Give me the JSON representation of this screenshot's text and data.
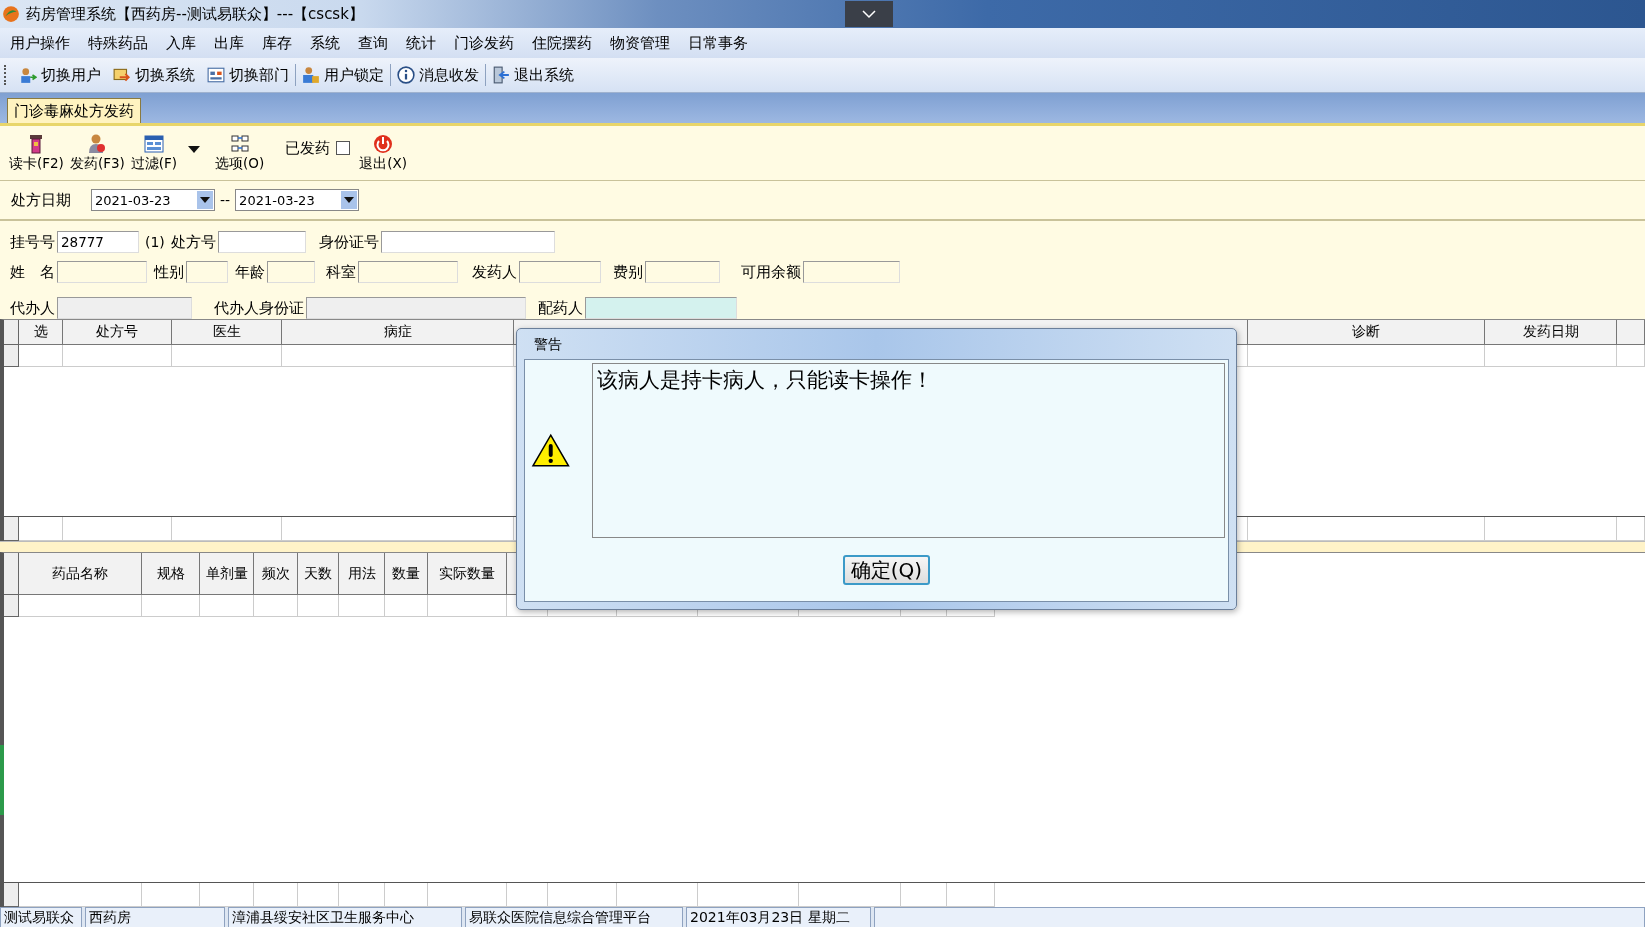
{
  "window": {
    "title": "药房管理系统【西药房--测试易联众】---【cscsk】"
  },
  "menu": [
    "用户操作",
    "特殊药品",
    "入库",
    "出库",
    "库存",
    "系统",
    "查询",
    "统计",
    "门诊发药",
    "住院摆药",
    "物资管理",
    "日常事务"
  ],
  "toolbar": [
    {
      "label": "切换用户",
      "kind": "user"
    },
    {
      "label": "切换系统",
      "kind": "switch"
    },
    {
      "label": "切换部门",
      "kind": "dept"
    },
    {
      "label": "用户锁定",
      "kind": "lock"
    },
    {
      "label": "消息收发",
      "kind": "info"
    },
    {
      "label": "退出系统",
      "kind": "exit"
    }
  ],
  "tabs": [
    {
      "label": "门诊毒麻处方发药",
      "selected": true
    }
  ],
  "actions": [
    {
      "label": "读卡(F2)",
      "kind": "card"
    },
    {
      "label": "发药(F3)",
      "kind": "person"
    },
    {
      "label": "过滤(F)",
      "kind": "filter"
    },
    {
      "label": "选项(O)",
      "kind": "options"
    },
    {
      "label": "已发药",
      "kind": "checkbox",
      "checked": false
    },
    {
      "label": "退出(X)",
      "kind": "power"
    }
  ],
  "date_filter": {
    "label": "处方日期",
    "from": "2021-03-23",
    "separator": "--",
    "to": "2021-03-23"
  },
  "form_rows": [
    [
      {
        "label": "挂号号",
        "value": "28777",
        "suffix": "(1)",
        "disabled": false,
        "focused": false
      },
      {
        "label": "处方号",
        "disabled": false,
        "focused": false
      },
      {
        "label": "身份证号",
        "disabled": false,
        "focused": false
      }
    ],
    [
      {
        "label": "姓　名",
        "disabled": false,
        "focused": false
      },
      {
        "label": "性别",
        "disabled": false,
        "focused": false
      },
      {
        "label": "年龄",
        "disabled": false,
        "focused": false
      },
      {
        "label": "科室",
        "disabled": false,
        "focused": false
      },
      {
        "label": "发药人",
        "disabled": false,
        "focused": false
      },
      {
        "label": "费别",
        "disabled": false,
        "focused": false
      },
      {
        "label": "可用余额",
        "disabled": false,
        "focused": false
      }
    ],
    [
      {
        "label": "代办人",
        "disabled": true,
        "focused": false
      },
      {
        "label": "代办人身份证",
        "disabled": true,
        "focused": false
      },
      {
        "label": "配药人",
        "disabled": false,
        "focused": true
      }
    ]
  ],
  "prescription_table": {
    "columns": [
      "选",
      "处方号",
      "医生",
      "病症",
      null,
      "诊断",
      "发药日期",
      null
    ]
  },
  "drug_table": {
    "columns": [
      "药品名称",
      "规格",
      "单剂量",
      "频次",
      "天数",
      "用法",
      "数量",
      "实际数量",
      null,
      null,
      null,
      null,
      null,
      null,
      null
    ]
  },
  "dialog": {
    "title": "警告",
    "message": "该病人是持卡病人，只能读卡操作！",
    "button": "确定(Q)"
  },
  "status_bar": [
    "测试易联众",
    "西药房",
    "漳浦县绥安社区卫生服务中心",
    "易联众医院信息综合管理平台",
    "2021年03月23日 星期二"
  ]
}
